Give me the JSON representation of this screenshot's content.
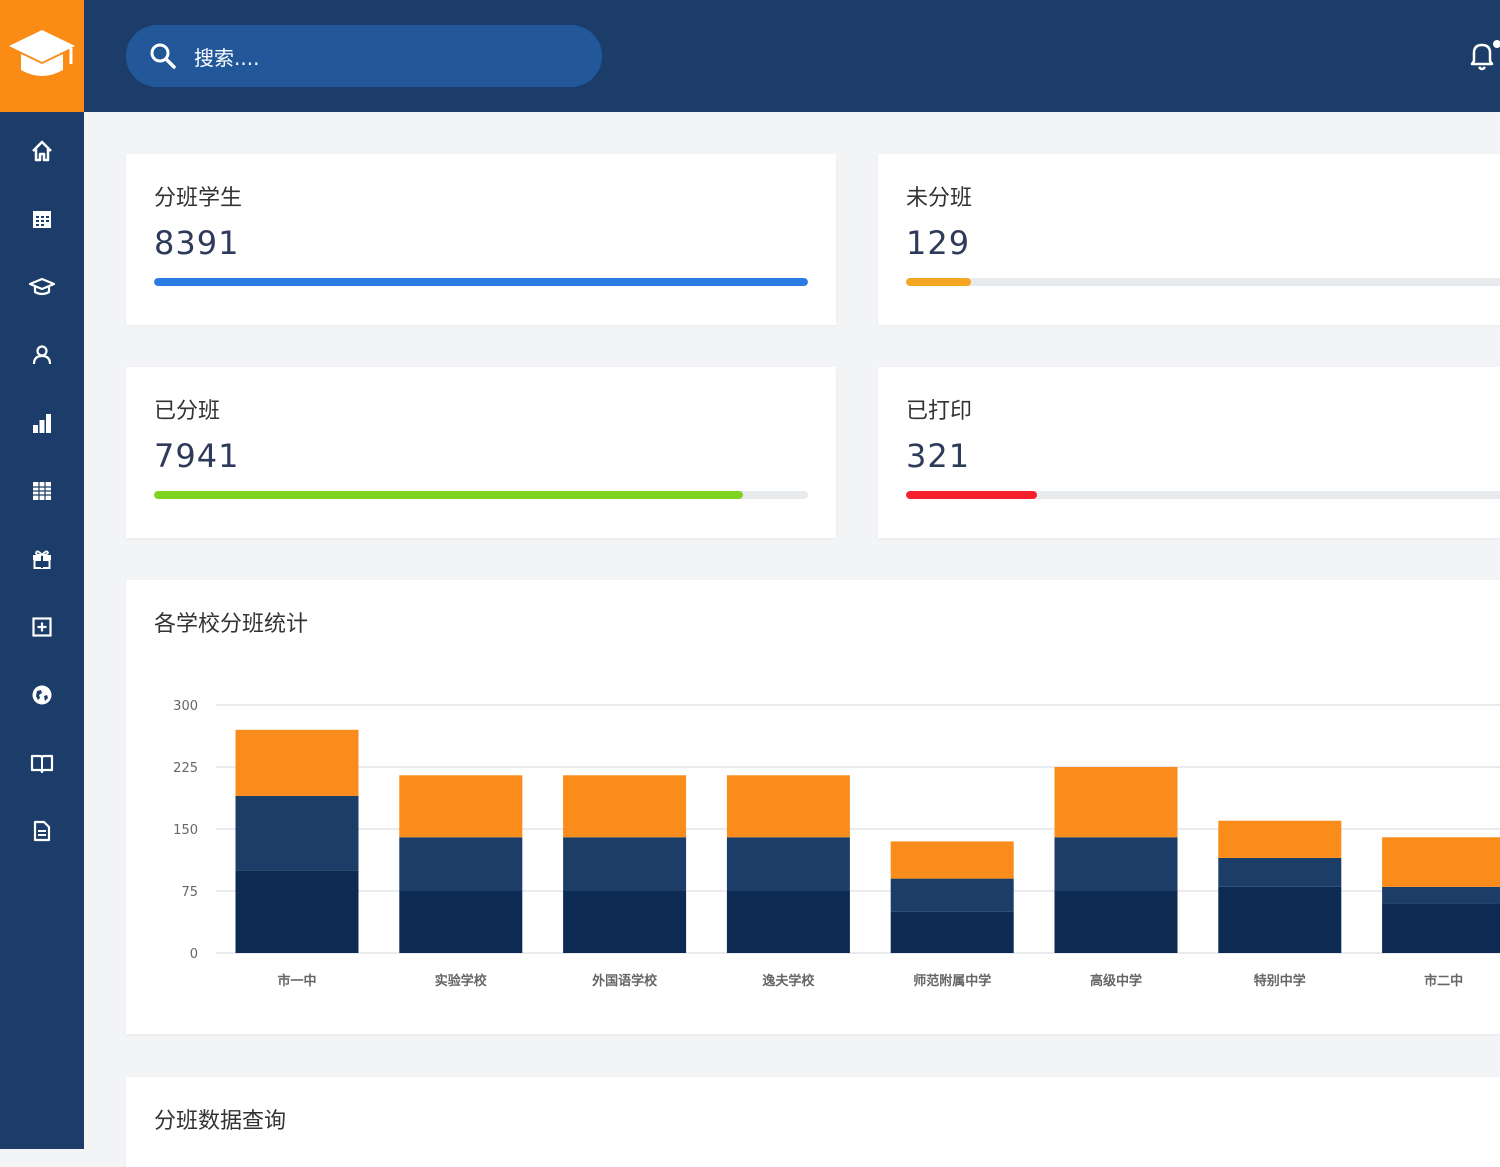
{
  "header": {
    "search_placeholder": "搜索....",
    "logo_icon": "graduation-cap-icon",
    "notification_icon": "bell-icon"
  },
  "sidebar": {
    "items": [
      {
        "icon": "home-icon"
      },
      {
        "icon": "calendar-icon"
      },
      {
        "icon": "graduation-cap-icon"
      },
      {
        "icon": "user-icon"
      },
      {
        "icon": "bar-chart-icon"
      },
      {
        "icon": "table-icon"
      },
      {
        "icon": "gift-icon"
      },
      {
        "icon": "plus-square-icon"
      },
      {
        "icon": "globe-icon"
      },
      {
        "icon": "book-icon"
      },
      {
        "icon": "document-icon"
      }
    ]
  },
  "stats": [
    {
      "label": "分班学生",
      "value": "8391",
      "progress": 1.0,
      "color": "#2b7be4"
    },
    {
      "label": "未分班",
      "value": "129",
      "progress": 0.1,
      "color": "#f5a623"
    },
    {
      "label": "已分班",
      "value": "7941",
      "progress": 0.9,
      "color": "#7ed321"
    },
    {
      "label": "已打印",
      "value": "321",
      "progress": 0.2,
      "color": "#f5222d"
    }
  ],
  "chart_card": {
    "title": "各学校分班统计"
  },
  "query_card": {
    "title": "分班数据查询"
  },
  "chart_data": {
    "type": "bar",
    "stacked": true,
    "categories": [
      "市一中",
      "实验学校",
      "外国语学校",
      "逸夫学校",
      "师范附属中学",
      "高级中学",
      "特别中学",
      "市二中"
    ],
    "series": [
      {
        "values": [
          100,
          75,
          75,
          75,
          50,
          75,
          80,
          60
        ],
        "color": "#0d2a52"
      },
      {
        "values": [
          90,
          65,
          65,
          65,
          40,
          65,
          35,
          20
        ],
        "color": "#1b3d68"
      },
      {
        "values": [
          80,
          75,
          75,
          75,
          45,
          85,
          45,
          60
        ],
        "color": "#fa8c1c"
      }
    ],
    "yticks": [
      0,
      75,
      150,
      225,
      300
    ],
    "ylim": [
      0,
      300
    ],
    "grid": true
  }
}
